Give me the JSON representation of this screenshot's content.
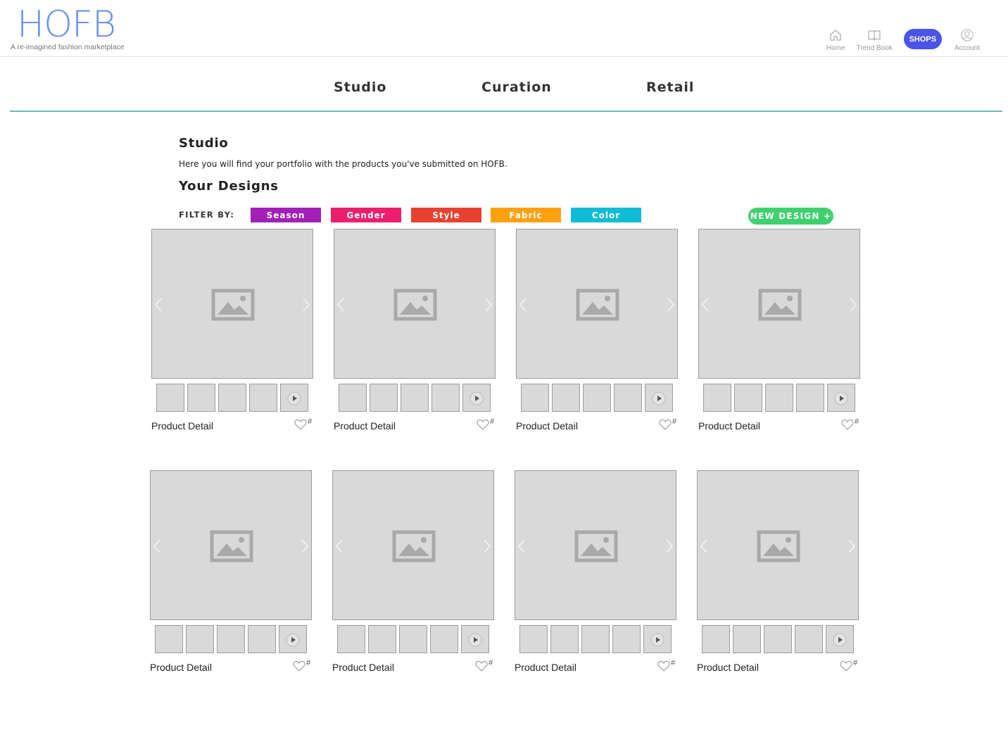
{
  "brand": {
    "logo": "HOFB",
    "tagline": "A re-imagined fashion marketplace",
    "accent_color": "#6b93ef"
  },
  "topnav": {
    "home_label": "Home",
    "trend_label": "Trend Book",
    "shops_label": "SHOPS",
    "account_label": "Account",
    "shops_color": "#4b54e6",
    "icons": [
      "home-icon",
      "book-icon",
      "user-icon"
    ]
  },
  "tabs": [
    "Studio",
    "Curation",
    "Retail"
  ],
  "studio": {
    "title": "Studio",
    "intro": "Here you will find your portfolio with the products you've submitted on HOFB.",
    "designs_title": "Your Designs"
  },
  "filters": {
    "label": "FILTER BY:",
    "chips": [
      {
        "label": "Season",
        "color": "#a21fb8"
      },
      {
        "label": "Gender",
        "color": "#ec1f6e"
      },
      {
        "label": "Style",
        "color": "#e84130"
      },
      {
        "label": "Fabric",
        "color": "#ffa10f"
      },
      {
        "label": "Color",
        "color": "#0fbcd6"
      }
    ]
  },
  "new_design": {
    "label": "NEW DESIGN +",
    "color": "#3fd16f"
  },
  "products": [
    {
      "label": "Product Detail",
      "count": "#"
    },
    {
      "label": "Product Detail",
      "count": "#"
    },
    {
      "label": "Product Detail",
      "count": "#"
    },
    {
      "label": "Product Detail",
      "count": "#"
    },
    {
      "label": "Product Detail",
      "count": "#"
    },
    {
      "label": "Product Detail",
      "count": "#"
    },
    {
      "label": "Product Detail",
      "count": "#"
    },
    {
      "label": "Product Detail",
      "count": "#"
    }
  ]
}
